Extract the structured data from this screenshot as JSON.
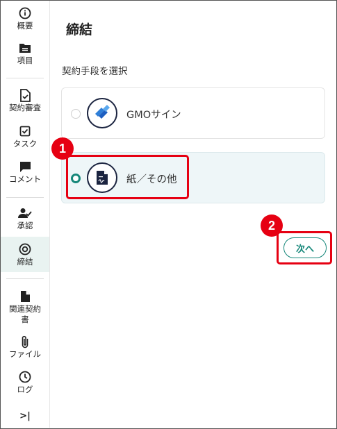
{
  "sidebar": {
    "items": [
      {
        "label": "概要",
        "icon": "info-icon"
      },
      {
        "label": "項目",
        "icon": "folder-icon"
      },
      {
        "label": "契約審査",
        "icon": "doc-check-icon"
      },
      {
        "label": "タスク",
        "icon": "checkbox-icon"
      },
      {
        "label": "コメント",
        "icon": "comment-icon"
      },
      {
        "label": "承認",
        "icon": "person-check-icon"
      },
      {
        "label": "締結",
        "icon": "target-icon"
      },
      {
        "label": "関連契約",
        "label2": "書",
        "icon": "document-icon"
      },
      {
        "label": "ファイル",
        "icon": "paperclip-icon"
      },
      {
        "label": "ログ",
        "icon": "clock-icon"
      }
    ],
    "collapse_icon": ">|"
  },
  "main": {
    "title": "締結",
    "section_label": "契約手段を選択",
    "options": [
      {
        "label": "GMOサイン",
        "selected": false,
        "icon": "gmo-sign-logo"
      },
      {
        "label": "紙／その他",
        "selected": true,
        "icon": "paper-document-icon"
      }
    ],
    "next_label": "次へ"
  },
  "annotations": {
    "badge1": "1",
    "badge2": "2",
    "highlight_color": "#e60012"
  },
  "colors": {
    "accent": "#16877a",
    "active_nav_bg": "#e9f3f1",
    "selected_option_bg": "#eef6f8"
  }
}
